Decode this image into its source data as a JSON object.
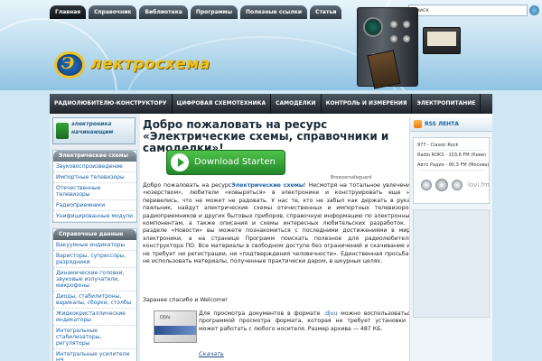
{
  "topnav": {
    "tabs": [
      "Главная",
      "Справочник",
      "Библиотека",
      "Программы",
      "Полезные ссылки",
      "Статьи"
    ]
  },
  "search": {
    "placeholder": "Поиск"
  },
  "logo": {
    "text": "лектросхема"
  },
  "mainnav": {
    "items": [
      "РАДИОЛЮБИТЕЛЮ-КОНСТРУКТОРУ",
      "ЦИФРОВАЯ СХЕМОТЕХНИКА",
      "САМОДЕЛКИ",
      "КОНТРОЛЬ И ИЗМЕРЕНИЯ",
      "ЭЛЕКТРОПИТАНИЕ"
    ]
  },
  "sidebar": {
    "badge_line1": "электроника",
    "badge_line2": "начинающим",
    "section1_title": "Электрические схемы",
    "section1_items": [
      "Звуковоспроизведение",
      "Импортные телевизоры",
      "Отечественные телевизоры",
      "Радиоприемники",
      "Унифицированные модули"
    ],
    "section2_title": "Справочные данные",
    "section2_items": [
      "Вакуумные индикаторы",
      "Варисторы, супрессоры, разрядники",
      "Динамические головки, звуковые излучатели, микрофоны",
      "Диоды, стабилитроны, варикапы, сборки, столбы",
      "Жидкокристаллические индикаторы",
      "Интегральные стабилизаторы, регуляторы",
      "Интегральные усилители НЧ"
    ]
  },
  "content": {
    "title": "Добро пожаловать на ресурс «Электрические схемы, справочники и самоделки»!",
    "download_button": "Download Starten",
    "ad_note": "Browsersafeguard",
    "intro": "Добро пожаловать на ресурс",
    "intro_bold": "Электрические схемы",
    "body": "! Несмотря на тотальное увлечение «юзерством», любители «ковыряться» в электронике и конструировать еще не перевелись, что не может не радовать. У нас те, кто не забыл как держать в руках паяльник, найдут электрические схемы отечественных и импортных телевизоров, радиоприемников и других бытовых приборов, справочную информацию по электронным компонентам, а также описания и схемы интересных любительских разработок. В разделе «Новости» вы можете познакомиться с последними достижениями в мире электроники, а на странице Программ поискать полезное для радиолюбителя-конструктора ПО. Все материалы в свободном доступе без ограничений и скачивание их не требует ни регистрации, ни «подтверждения человечности». Единственная просьба – не использовать материалы, полученные практически даром, в шкурных целях.",
    "thanks": "Заранее спасибо и Welcome!",
    "djvu_icon_label": "DjVu",
    "djvu_pre": "Для просмотра документов в формате",
    "djvu_ext": ".djvu",
    "djvu_post": "можно воспользоваться программой просмотра формата, которая не требует установки и может работать с любого носителя. Размер архива — 487 КБ.",
    "download_link": "Скачать"
  },
  "right": {
    "rss_label": "RSS ЛЕНТА",
    "stations": [
      "977 - Classic Rock",
      "Radio ROKS - 103,6 FM (Киев)",
      "Авто Радио - 90,3 FM (Москва)"
    ],
    "player_logo": "lovi.fm"
  }
}
